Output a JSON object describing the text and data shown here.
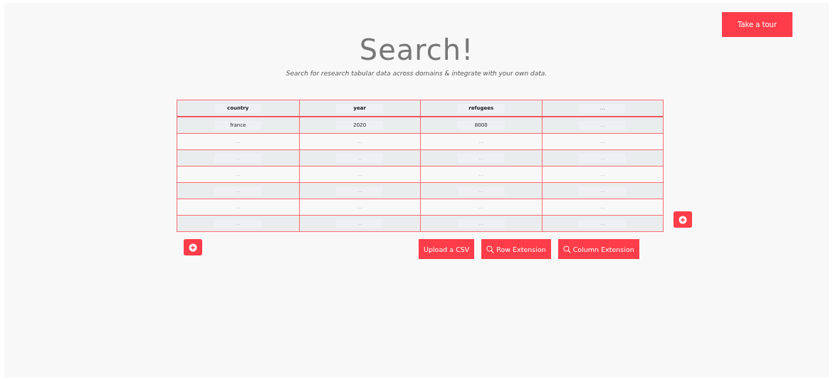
{
  "tour_button": "Take a tour",
  "title": "Search!",
  "subtitle": "Search for research tabular data across domains & integrate with your own data.",
  "table": {
    "columns": [
      {
        "value": "country"
      },
      {
        "value": "year"
      },
      {
        "value": "refugees"
      },
      {
        "placeholder": "..."
      }
    ],
    "rows": [
      [
        {
          "value": "france"
        },
        {
          "value": "2020"
        },
        {
          "value": "8000"
        },
        {
          "placeholder": "..."
        }
      ],
      [
        {
          "placeholder": "..."
        },
        {
          "placeholder": "..."
        },
        {
          "placeholder": "..."
        },
        {
          "placeholder": "..."
        }
      ],
      [
        {
          "placeholder": "..."
        },
        {
          "placeholder": "..."
        },
        {
          "placeholder": "..."
        },
        {
          "placeholder": "..."
        }
      ],
      [
        {
          "placeholder": "..."
        },
        {
          "placeholder": "..."
        },
        {
          "placeholder": "..."
        },
        {
          "placeholder": "..."
        }
      ],
      [
        {
          "placeholder": "..."
        },
        {
          "placeholder": "..."
        },
        {
          "placeholder": "..."
        },
        {
          "placeholder": "..."
        }
      ],
      [
        {
          "placeholder": "..."
        },
        {
          "placeholder": "..."
        },
        {
          "placeholder": "..."
        },
        {
          "placeholder": "..."
        }
      ],
      [
        {
          "placeholder": "..."
        },
        {
          "placeholder": "..."
        },
        {
          "placeholder": "..."
        },
        {
          "placeholder": "..."
        }
      ]
    ]
  },
  "actions": [
    {
      "label": "Upload a CSV",
      "kind": "upload"
    },
    {
      "label": "Row Extension",
      "kind": "extension"
    },
    {
      "label": "Column Extension",
      "kind": "extension"
    }
  ]
}
